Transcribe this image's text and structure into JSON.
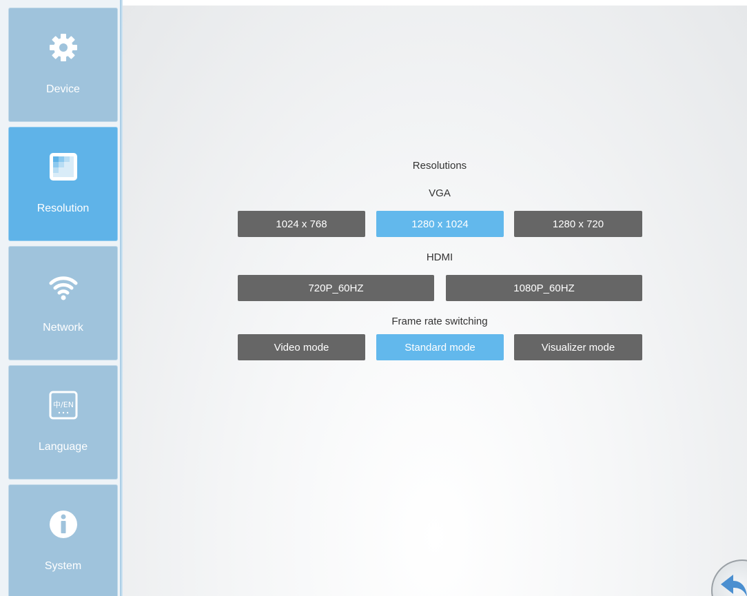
{
  "sidebar": {
    "items": [
      {
        "label": "Device",
        "icon": "gear-icon"
      },
      {
        "label": "Resolution",
        "icon": "resolution-icon"
      },
      {
        "label": "Network",
        "icon": "wifi-icon"
      },
      {
        "label": "Language",
        "icon": "language-icon",
        "icon_text": "中/EN"
      },
      {
        "label": "System",
        "icon": "info-icon"
      }
    ],
    "active_index": 1
  },
  "main": {
    "header": "Resolutions",
    "vga": {
      "title": "VGA",
      "options": [
        "1024 x 768",
        "1280 x 1024",
        "1280 x 720"
      ],
      "selected": "1280 x 1024"
    },
    "hdmi": {
      "title": "HDMI",
      "options": [
        "720P_60HZ",
        "1080P_60HZ"
      ]
    },
    "frame_rate": {
      "title": "Frame rate switching",
      "options": [
        "Video mode",
        "Standard mode",
        "Visualizer mode"
      ],
      "selected": "Standard mode"
    }
  },
  "colors": {
    "sidebar_item": "#9fc3dc",
    "sidebar_active": "#5fb3e8",
    "button_default": "#666666",
    "button_selected": "#62b8ec"
  },
  "back_button": {
    "icon": "back-arrow-icon"
  }
}
